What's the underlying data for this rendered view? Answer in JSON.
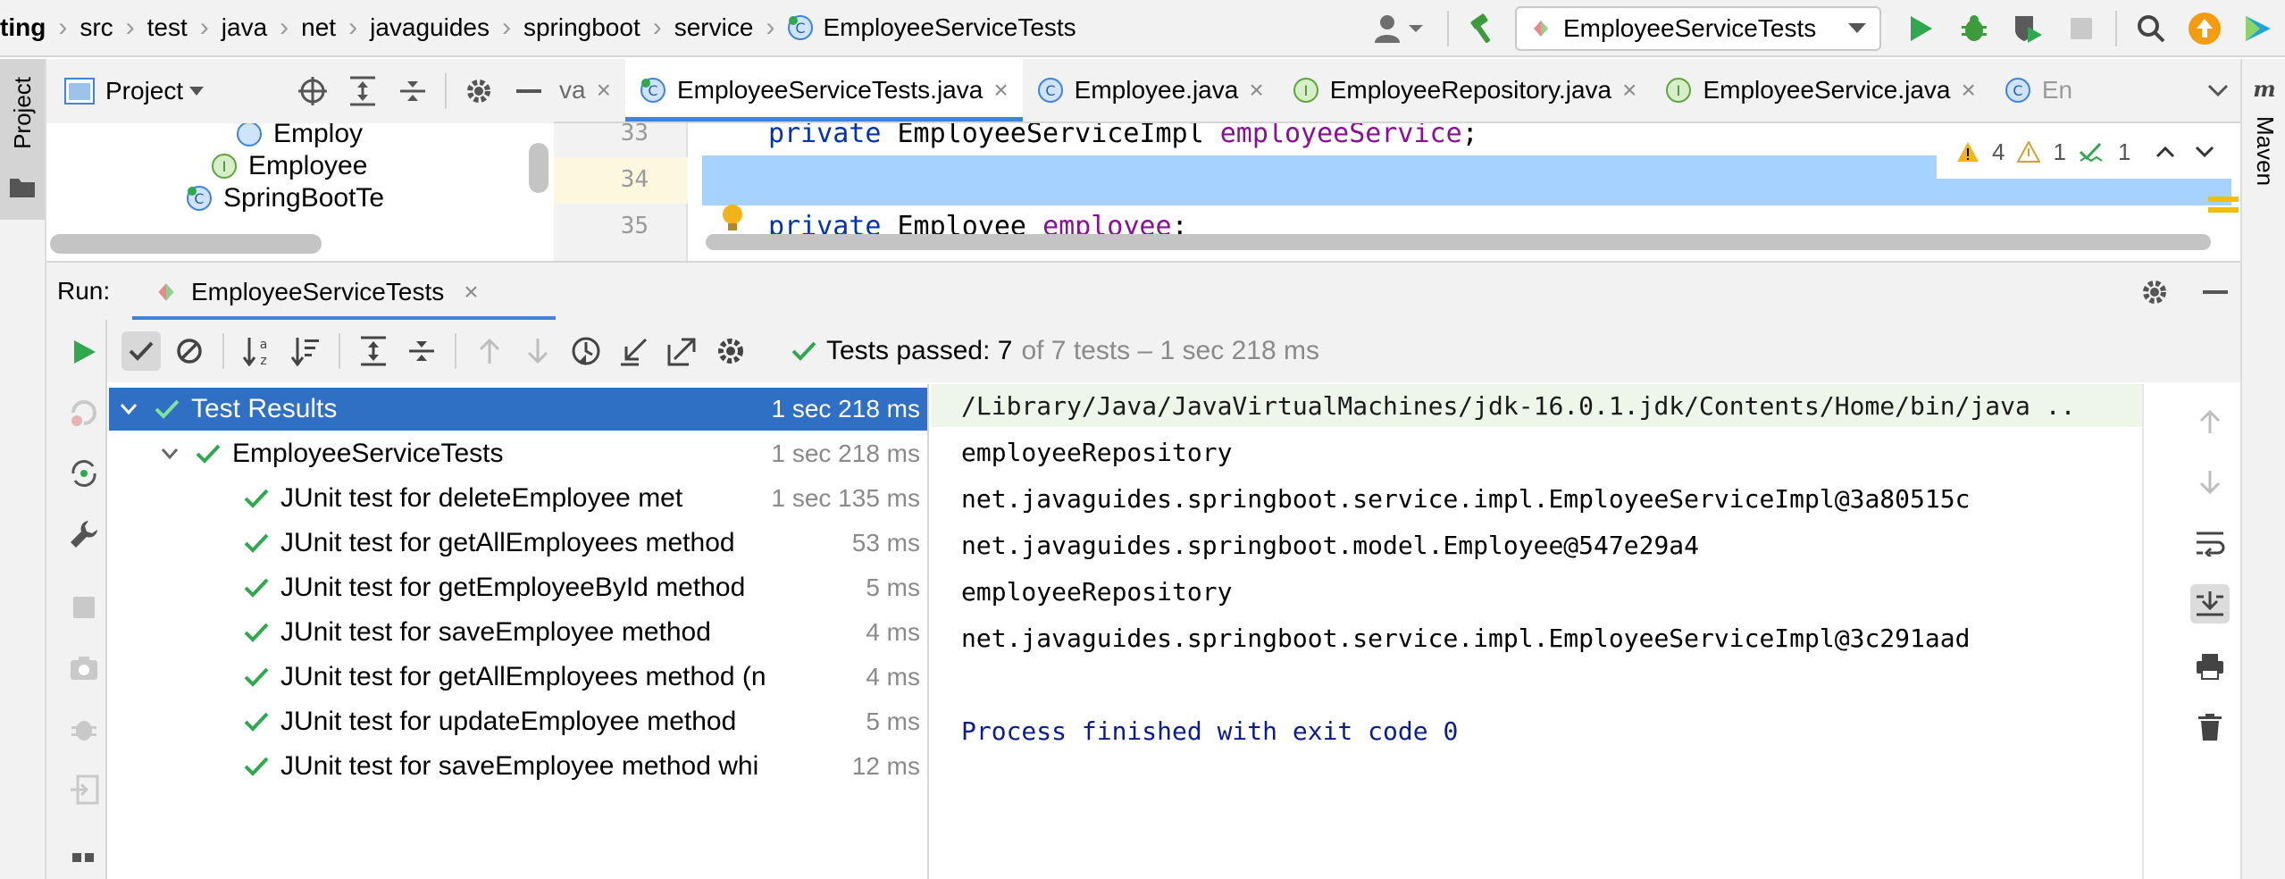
{
  "breadcrumb": {
    "items": [
      "ting",
      "src",
      "test",
      "java",
      "net",
      "javaguides",
      "springboot",
      "service"
    ],
    "file": "EmployeeServiceTests"
  },
  "toolbar": {
    "run_config": "EmployeeServiceTests"
  },
  "left_strip": {
    "project_tab": "Project"
  },
  "right_strip": {
    "maven_tab": "Maven"
  },
  "project_panel": {
    "title": "Project",
    "tree": [
      {
        "label": "Employ",
        "icon": "class-icon"
      },
      {
        "label": "Employee",
        "icon": "interface-icon"
      },
      {
        "label": "SpringBootTe",
        "icon": "test-class-icon"
      }
    ]
  },
  "editor": {
    "tabs": [
      {
        "label": "va",
        "kind": "partial"
      },
      {
        "label": "EmployeeServiceTests.java",
        "kind": "test-class"
      },
      {
        "label": "Employee.java",
        "kind": "class"
      },
      {
        "label": "EmployeeRepository.java",
        "kind": "interface"
      },
      {
        "label": "EmployeeService.java",
        "kind": "interface"
      },
      {
        "label": "En",
        "kind": "class"
      }
    ],
    "line_numbers": [
      "33",
      "34",
      "35"
    ],
    "line33": {
      "kw": "private",
      "type": " EmployeeServiceImpl ",
      "field": "employeeService",
      "end": ";"
    },
    "line35": {
      "kw": "private",
      "type": " Employee ",
      "field": "employee",
      "end": ";"
    },
    "inspections": {
      "warnings": "4",
      "weak_warnings": "1",
      "typos": "1"
    }
  },
  "run": {
    "label": "Run:",
    "tab": "EmployeeServiceTests",
    "summary": {
      "passed": "Tests passed: 7",
      "rest": "of 7 tests – 1 sec 218 ms"
    },
    "results": [
      {
        "label": "Test Results",
        "time": "1 sec 218 ms",
        "level": 0
      },
      {
        "label": "EmployeeServiceTests",
        "time": "1 sec 218 ms",
        "level": 1
      },
      {
        "label": "JUnit test for deleteEmployee met",
        "time": "1 sec 135 ms",
        "level": 2
      },
      {
        "label": "JUnit test for getAllEmployees method",
        "time": "53 ms",
        "level": 2
      },
      {
        "label": "JUnit test for getEmployeeById method",
        "time": "5 ms",
        "level": 2
      },
      {
        "label": "JUnit test for saveEmployee method",
        "time": "4 ms",
        "level": 2
      },
      {
        "label": "JUnit test for getAllEmployees method (n",
        "time": "4 ms",
        "level": 2
      },
      {
        "label": "JUnit test for updateEmployee method",
        "time": "5 ms",
        "level": 2
      },
      {
        "label": "JUnit test for saveEmployee method whi",
        "time": "12 ms",
        "level": 2
      }
    ],
    "console": [
      "/Library/Java/JavaVirtualMachines/jdk-16.0.1.jdk/Contents/Home/bin/java ..",
      "employeeRepository",
      "net.javaguides.springboot.service.impl.EmployeeServiceImpl@3a80515c",
      "net.javaguides.springboot.model.Employee@547e29a4",
      "employeeRepository",
      "net.javaguides.springboot.service.impl.EmployeeServiceImpl@3c291aad",
      "",
      "Process finished with exit code 0"
    ]
  },
  "colors": {
    "accent": "#3f83d8",
    "selection": "#2f6fc4",
    "pass": "#2fa84f",
    "keyword": "#0033b3",
    "field": "#871094"
  }
}
